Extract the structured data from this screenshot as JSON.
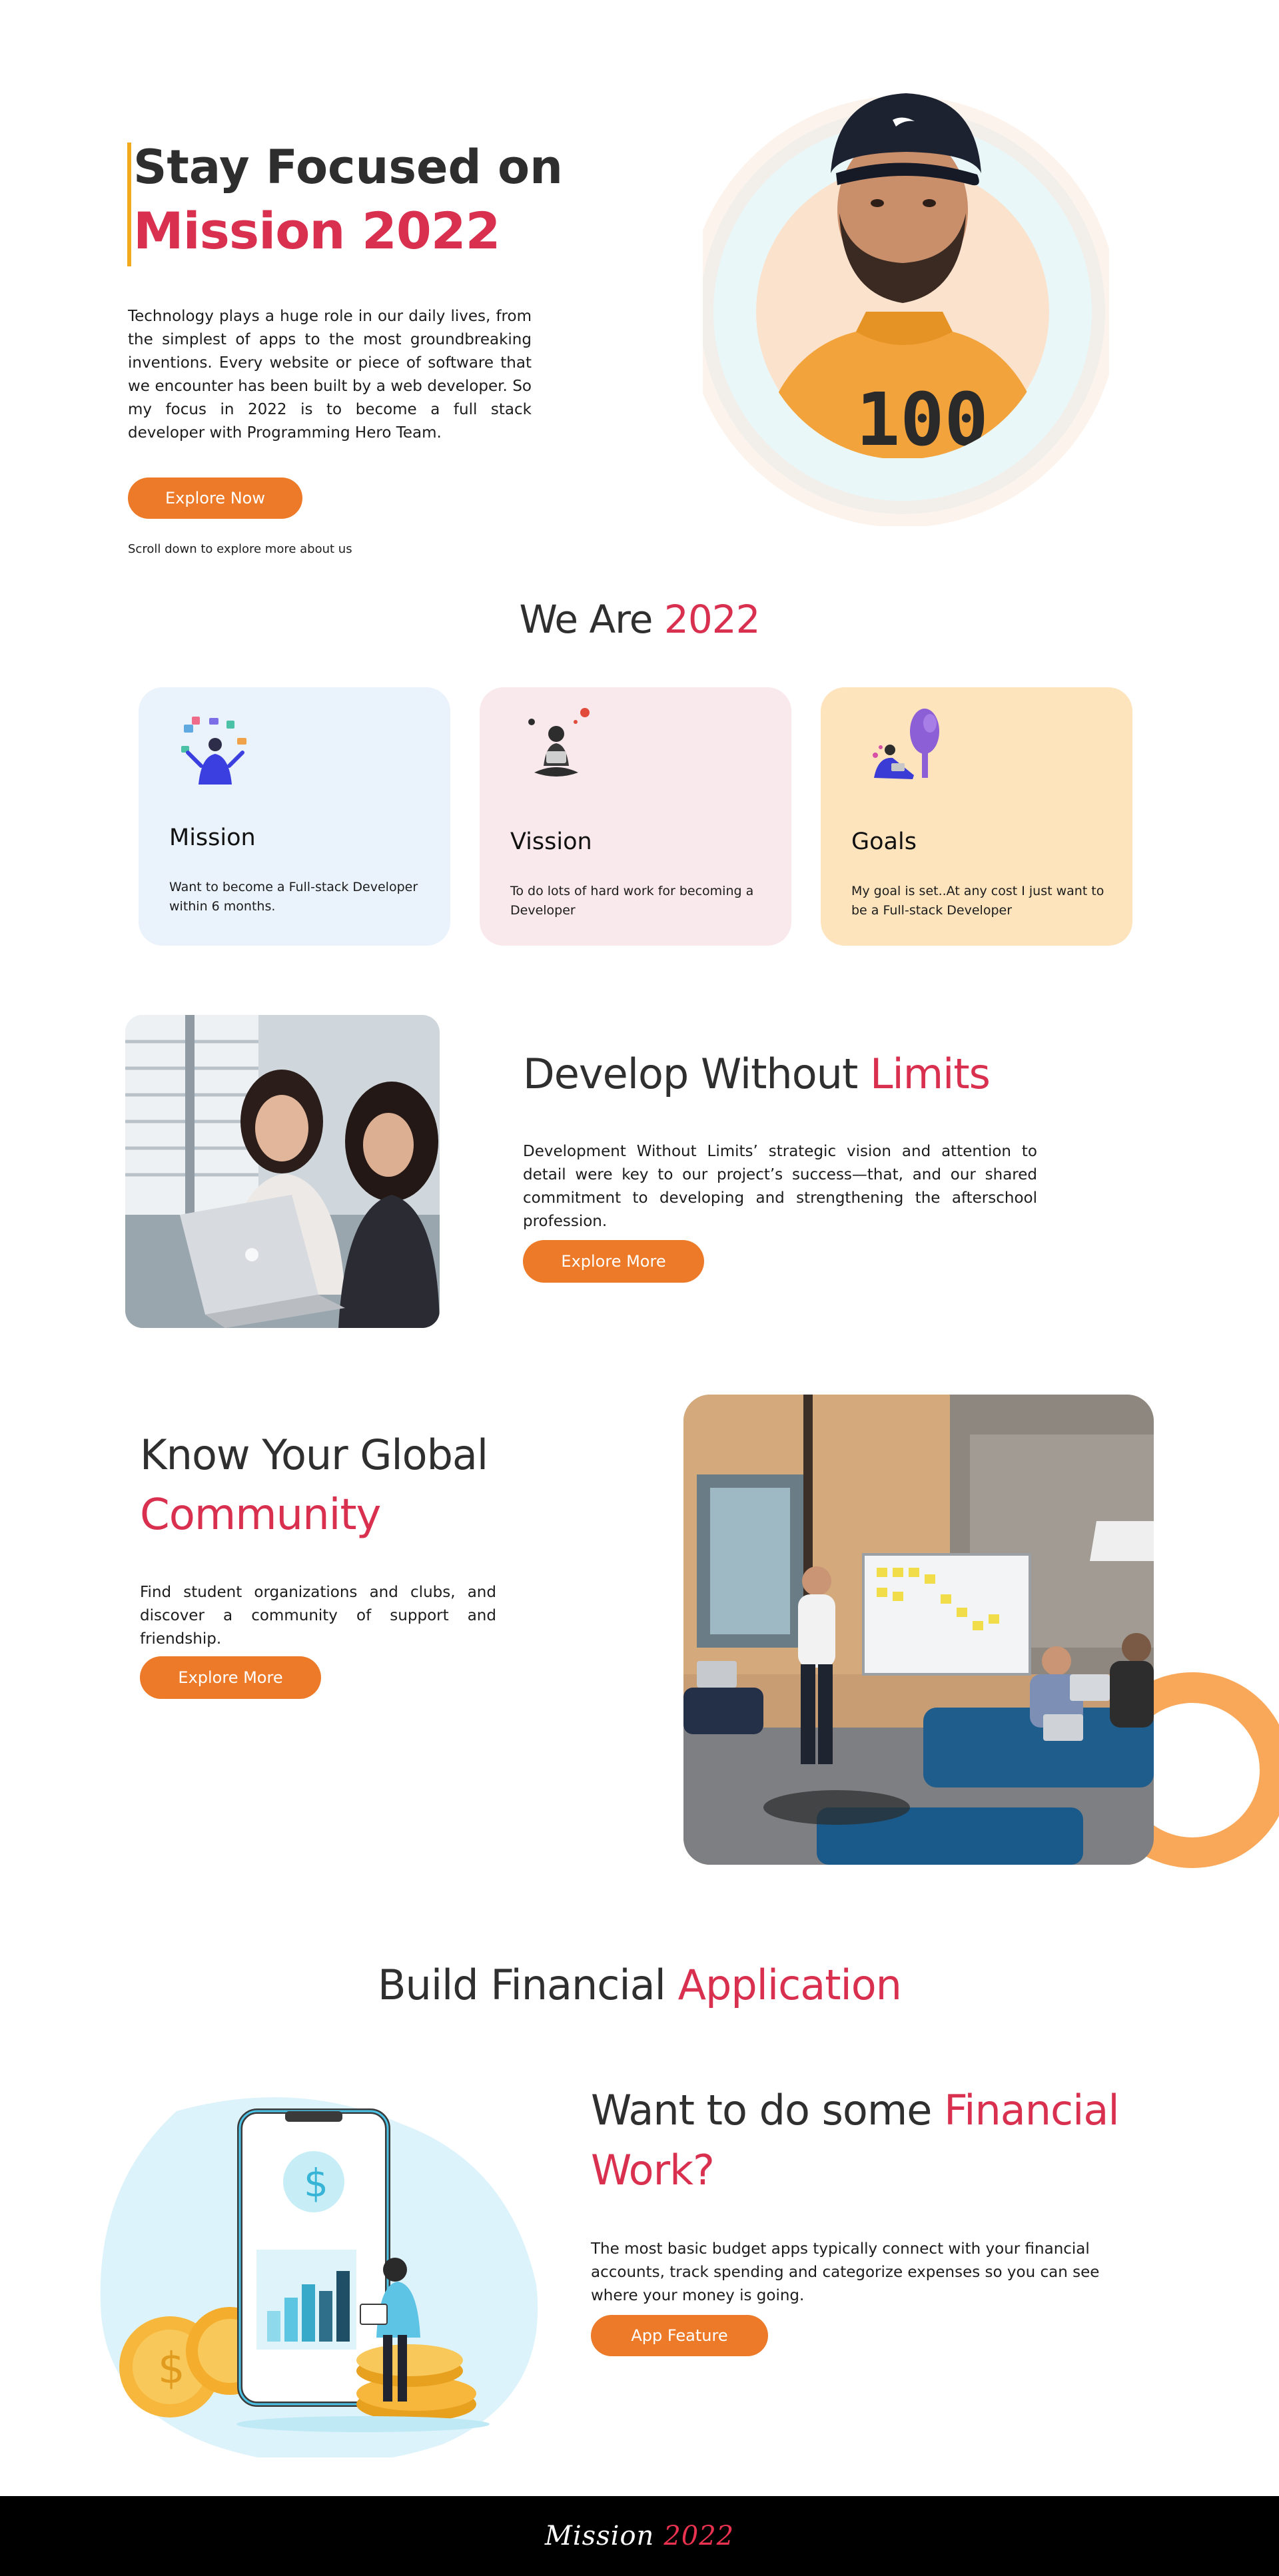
{
  "colors": {
    "accent_red": "#d8304e",
    "button_orange": "#ec7a28",
    "hero_bar_yellow": "#f2a91b",
    "card_blue": "#eaf2fb",
    "card_pink": "#f9e8ec",
    "card_peach": "#fde4bd",
    "footer_bg": "#000000"
  },
  "hero": {
    "title_line1": "Stay Focused on",
    "title_line2": "Mission 2022",
    "description": "Technology plays a huge role in our daily lives, from the simplest of apps to the most groundbreaking inventions. Every website or piece of software that we encounter has been built by a web developer. So my focus in 2022 is to become a full stack developer with Programming Hero Team.",
    "button_label": "Explore Now",
    "scroll_hint": "Scroll down to explore more about us",
    "cap_text": "",
    "shirt_text": "100"
  },
  "we_are": {
    "heading_prefix": "We Are",
    "heading_accent": "2022",
    "cards": [
      {
        "title": "Mission",
        "text": "Want to become a Full-stack Developer within 6 months.",
        "icon": "juggling-person-icon"
      },
      {
        "title": "Vission",
        "text": "To do lots of hard work for becoming a Developer",
        "icon": "meditating-person-icon"
      },
      {
        "title": "Goals",
        "text": "My goal is set..At any cost I just want to be a Full-stack Developer",
        "icon": "person-under-tree-icon"
      }
    ]
  },
  "develop": {
    "title_prefix": "Develop Without",
    "title_accent": "Limits",
    "description": "Development Without Limits’ strategic vision and attention to detail were key to our project’s success—that, and our shared commitment to developing and strengthening the afterschool profession.",
    "button_label": "Explore More"
  },
  "community": {
    "title_line1": "Know Your Global",
    "title_line2": "Community",
    "description": "Find student organizations and clubs, and discover a community of support and friendship.",
    "button_label": "Explore More"
  },
  "finance": {
    "heading_prefix": "Build Financial",
    "heading_accent": "Application",
    "title_prefix": "Want to do some",
    "title_accent": "Financial",
    "title_line2": "Work?",
    "description": "The most basic budget apps typically connect with your financial accounts, track spending and categorize expenses so you can see where your money is going.",
    "button_label": "App Feature",
    "phone_symbol": "$"
  },
  "footer": {
    "logo_word": "Mission",
    "logo_year": "2022"
  }
}
